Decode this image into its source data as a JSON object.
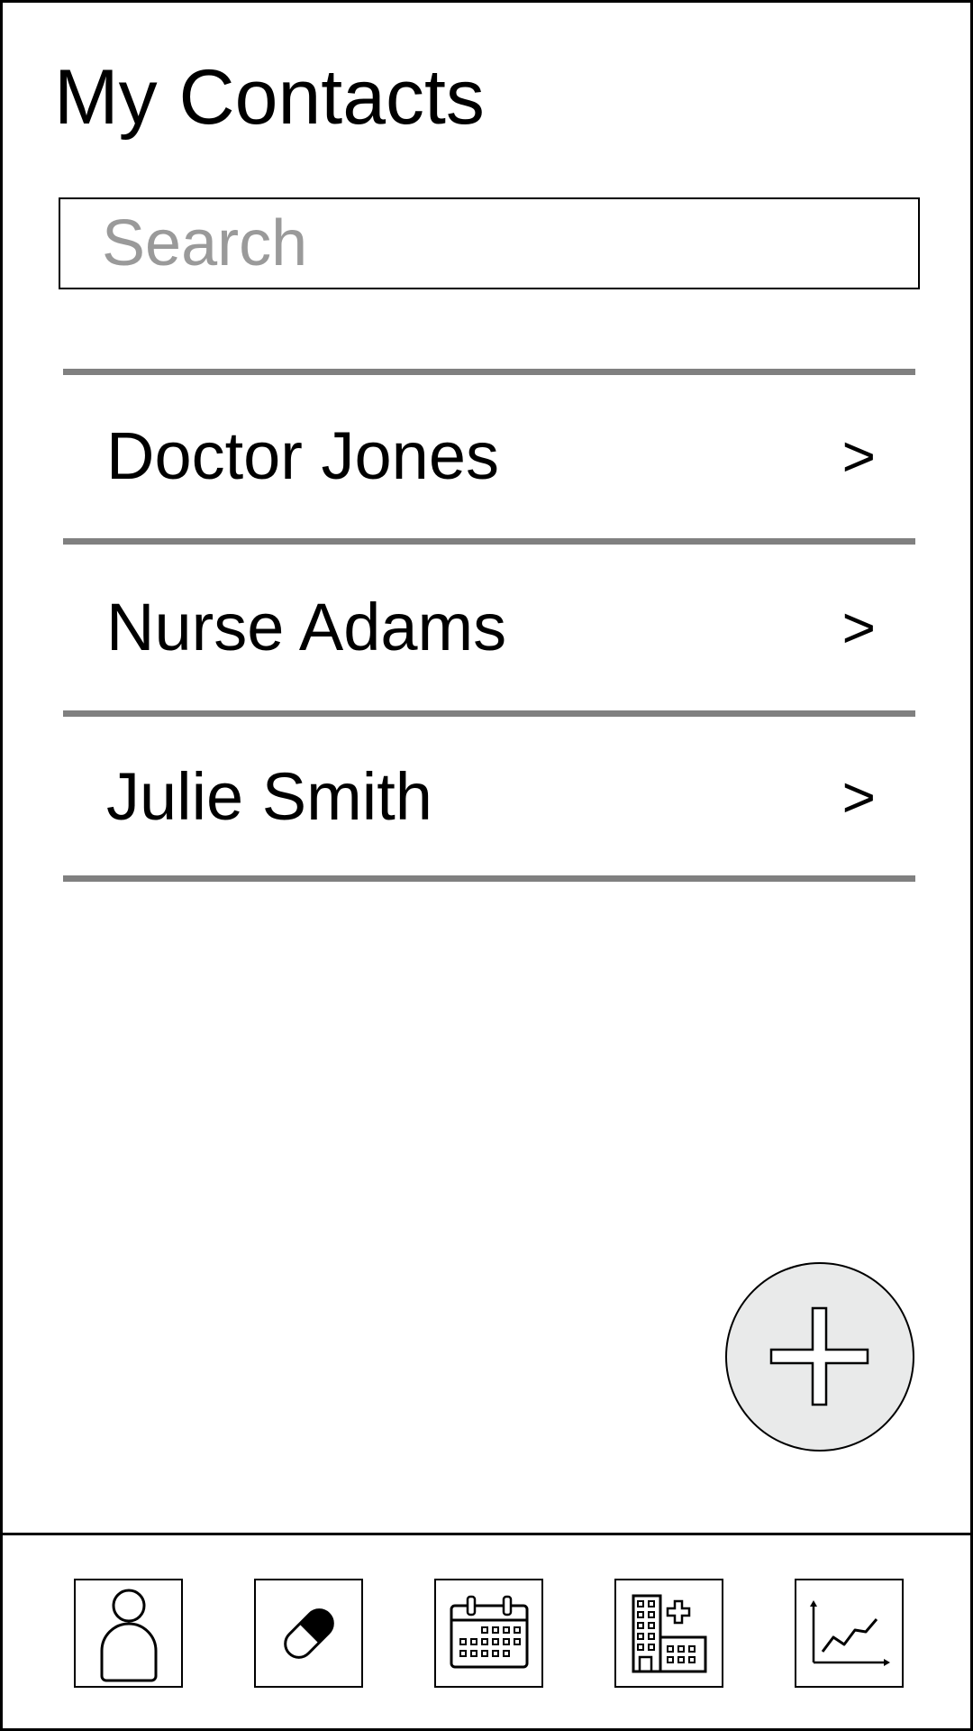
{
  "header": {
    "title": "My Contacts"
  },
  "search": {
    "placeholder": "Search",
    "value": ""
  },
  "contacts": [
    {
      "name": "Doctor Jones",
      "chevron": ">"
    },
    {
      "name": "Nurse Adams",
      "chevron": ">"
    },
    {
      "name": "Julie Smith",
      "chevron": ">"
    }
  ],
  "fab": {
    "icon": "plus-icon"
  },
  "bottom_nav": [
    {
      "icon": "person-icon"
    },
    {
      "icon": "pill-icon"
    },
    {
      "icon": "calendar-icon"
    },
    {
      "icon": "hospital-icon"
    },
    {
      "icon": "line-chart-icon"
    }
  ],
  "colors": {
    "divider": "#808080",
    "placeholder": "#9a9a9a",
    "fab_fill": "#e9eaea",
    "stroke": "#000000"
  }
}
